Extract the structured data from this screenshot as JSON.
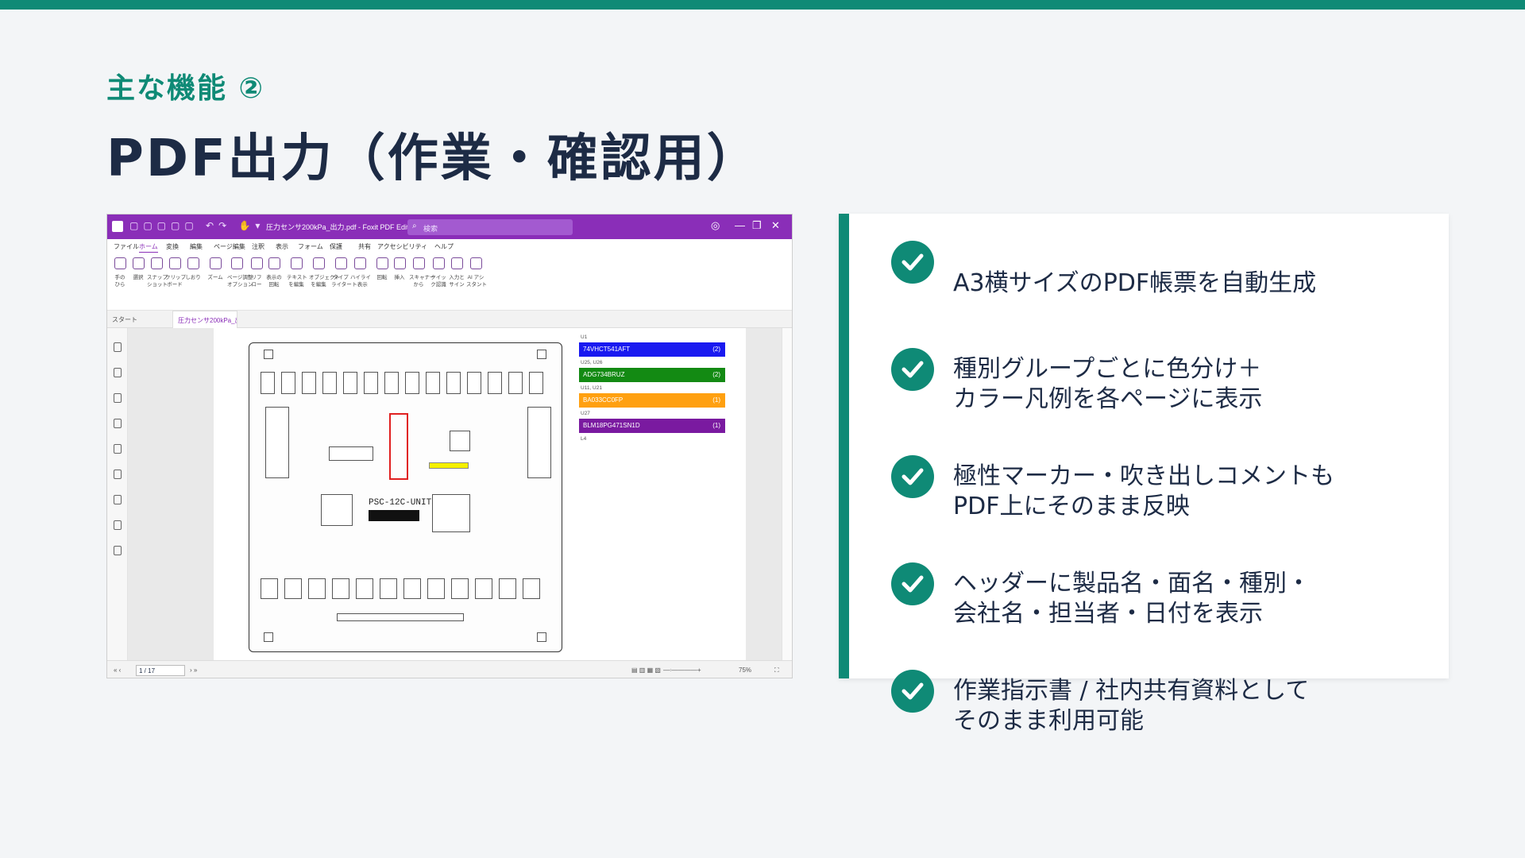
{
  "slide": {
    "subtitle": "主な機能 ②",
    "title": "PDF出力（作業・確認用）"
  },
  "app": {
    "filename": "圧力センサ200kPa_出力.pdf - Foxit PDF Editor",
    "search_placeholder": "検索",
    "menu": [
      "ファイル",
      "ホーム",
      "変換",
      "編集",
      "ページ編集",
      "注釈",
      "表示",
      "フォーム",
      "保護",
      "共有",
      "アクセシビリティ",
      "ヘルプ"
    ],
    "active_menu": "ホーム",
    "ribbon": [
      {
        "label": "手の\nひら",
        "icon": "hand-icon"
      },
      {
        "label": "選択",
        "icon": "select-icon"
      },
      {
        "label": "スナップ\nショット",
        "icon": "snapshot-icon"
      },
      {
        "label": "クリップ\nボード",
        "icon": "clipboard-icon"
      },
      {
        "label": "しおり",
        "icon": "bookmark-icon"
      },
      {
        "label": "ズーム",
        "icon": "zoom-icon"
      },
      {
        "label": "ページ調整\nオプション",
        "icon": "page-adjust-icon"
      },
      {
        "label": "リフ\nロー",
        "icon": "reflow-icon"
      },
      {
        "label": "表示の\n回転",
        "icon": "rotate-view-icon"
      },
      {
        "label": "テキスト\nを編集",
        "icon": "edit-text-icon"
      },
      {
        "label": "オブジェクト\nを編集",
        "icon": "edit-object-icon"
      },
      {
        "label": "タイプ\nライター",
        "icon": "typewriter-icon"
      },
      {
        "label": "ハイライ\nト表示",
        "icon": "highlight-icon"
      },
      {
        "label": "回転",
        "icon": "rotate-icon"
      },
      {
        "label": "挿入",
        "icon": "insert-icon"
      },
      {
        "label": "スキャナー\nから",
        "icon": "scanner-icon"
      },
      {
        "label": "クイッ\nク認識",
        "icon": "ocr-icon"
      },
      {
        "label": "入力と\nサイン",
        "icon": "sign-icon"
      },
      {
        "label": "AI アシ\nスタント",
        "icon": "ai-assistant-icon"
      }
    ],
    "tabs": [
      "スタート",
      "圧力センサ200kPa_出..."
    ],
    "legend": [
      {
        "sub": "U1",
        "label": "74VHCT541AFT",
        "count": "(2)",
        "color": "#1919f0"
      },
      {
        "sub": "U25, U26",
        "label": "ADG734BRUZ",
        "count": "(2)",
        "color": "#138a13"
      },
      {
        "sub": "U11, U21",
        "label": "BA033CC0FP",
        "count": "(1)",
        "color": "#ffa010"
      },
      {
        "sub": "U27",
        "label": "BLM18PG471SN1D",
        "count": "(1)",
        "color": "#7a1aa0"
      },
      {
        "sub": "L4",
        "label": "",
        "count": "",
        "color": ""
      }
    ],
    "board_label": "PSC-12C-UNIT",
    "page_indicator": "1 / 17",
    "zoom": "75%"
  },
  "features": [
    {
      "line1": "A3横サイズのPDF帳票を自動生成",
      "line2": ""
    },
    {
      "line1": "種別グループごとに色分け＋",
      "line2": "カラー凡例を各ページに表示"
    },
    {
      "line1": "極性マーカー・吹き出しコメントも",
      "line2": "PDF上にそのまま反映"
    },
    {
      "line1": "ヘッダーに製品名・面名・種別・",
      "line2": "会社名・担当者・日付を表示"
    },
    {
      "line1": "作業指示書 / 社内共有資料として",
      "line2": "そのまま利用可能"
    }
  ],
  "colors": {
    "accent": "#0f8a76",
    "title": "#1d2b45",
    "foxit": "#8a2eb8"
  }
}
